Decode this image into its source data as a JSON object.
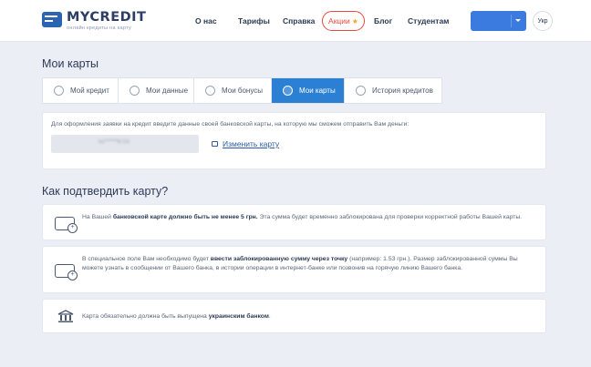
{
  "header": {
    "logo_title": "MYCREDIT",
    "logo_subtitle": "онлайн кредиты на карту",
    "nav": [
      {
        "label": "О нас"
      },
      {
        "label": "Тарифы"
      },
      {
        "label": "Справка"
      },
      {
        "label": "Блог"
      },
      {
        "label": "Студентам"
      }
    ],
    "promo_label": "Акции",
    "lang_label": "Укр"
  },
  "page_title": "Мои карты",
  "tabs": [
    {
      "label": "Мой кредит",
      "icon": "thumbs-up-icon",
      "active": false
    },
    {
      "label": "Мои данные",
      "icon": "user-icon",
      "active": false
    },
    {
      "label": "Мои бонусы",
      "icon": "star-icon",
      "active": false
    },
    {
      "label": "Мои карты",
      "icon": "card-icon",
      "active": true
    },
    {
      "label": "История кредитов",
      "icon": "list-icon",
      "active": false
    }
  ],
  "card": {
    "hint": "Для оформления заявки на кредит введите данные своей банковской карты, на которую мы сможем отправить Вам деньги:",
    "masked_number": "51******8715",
    "change_label": "Изменить карту"
  },
  "section_title": "Как подтвердить карту?",
  "info": [
    {
      "pre": "На Вашей ",
      "bold": "банковской карте должно быть не менее 5 грн.",
      "post": " Эта сумма будет временно заблокирована для проверки корректной работы Вашей карты."
    },
    {
      "pre": "В специальное поле Вам необходимо будет ",
      "bold": "ввести заблокированную сумму через точку",
      "post": " (например: 1.53 грн.). Размер заблокированной суммы Вы можете узнать в сообщении от Вашего банка, в истории операции в интернет-банке или позвонив на горячую линию Вашего банка."
    },
    {
      "pre": "Карта обязательно должна быть выпущена ",
      "bold": "украинским банком",
      "post": "."
    }
  ],
  "colors": {
    "brand": "#2c64b4",
    "accent_blue": "#2c80d3",
    "promo_red": "#e7493c",
    "background": "#eceef6"
  }
}
